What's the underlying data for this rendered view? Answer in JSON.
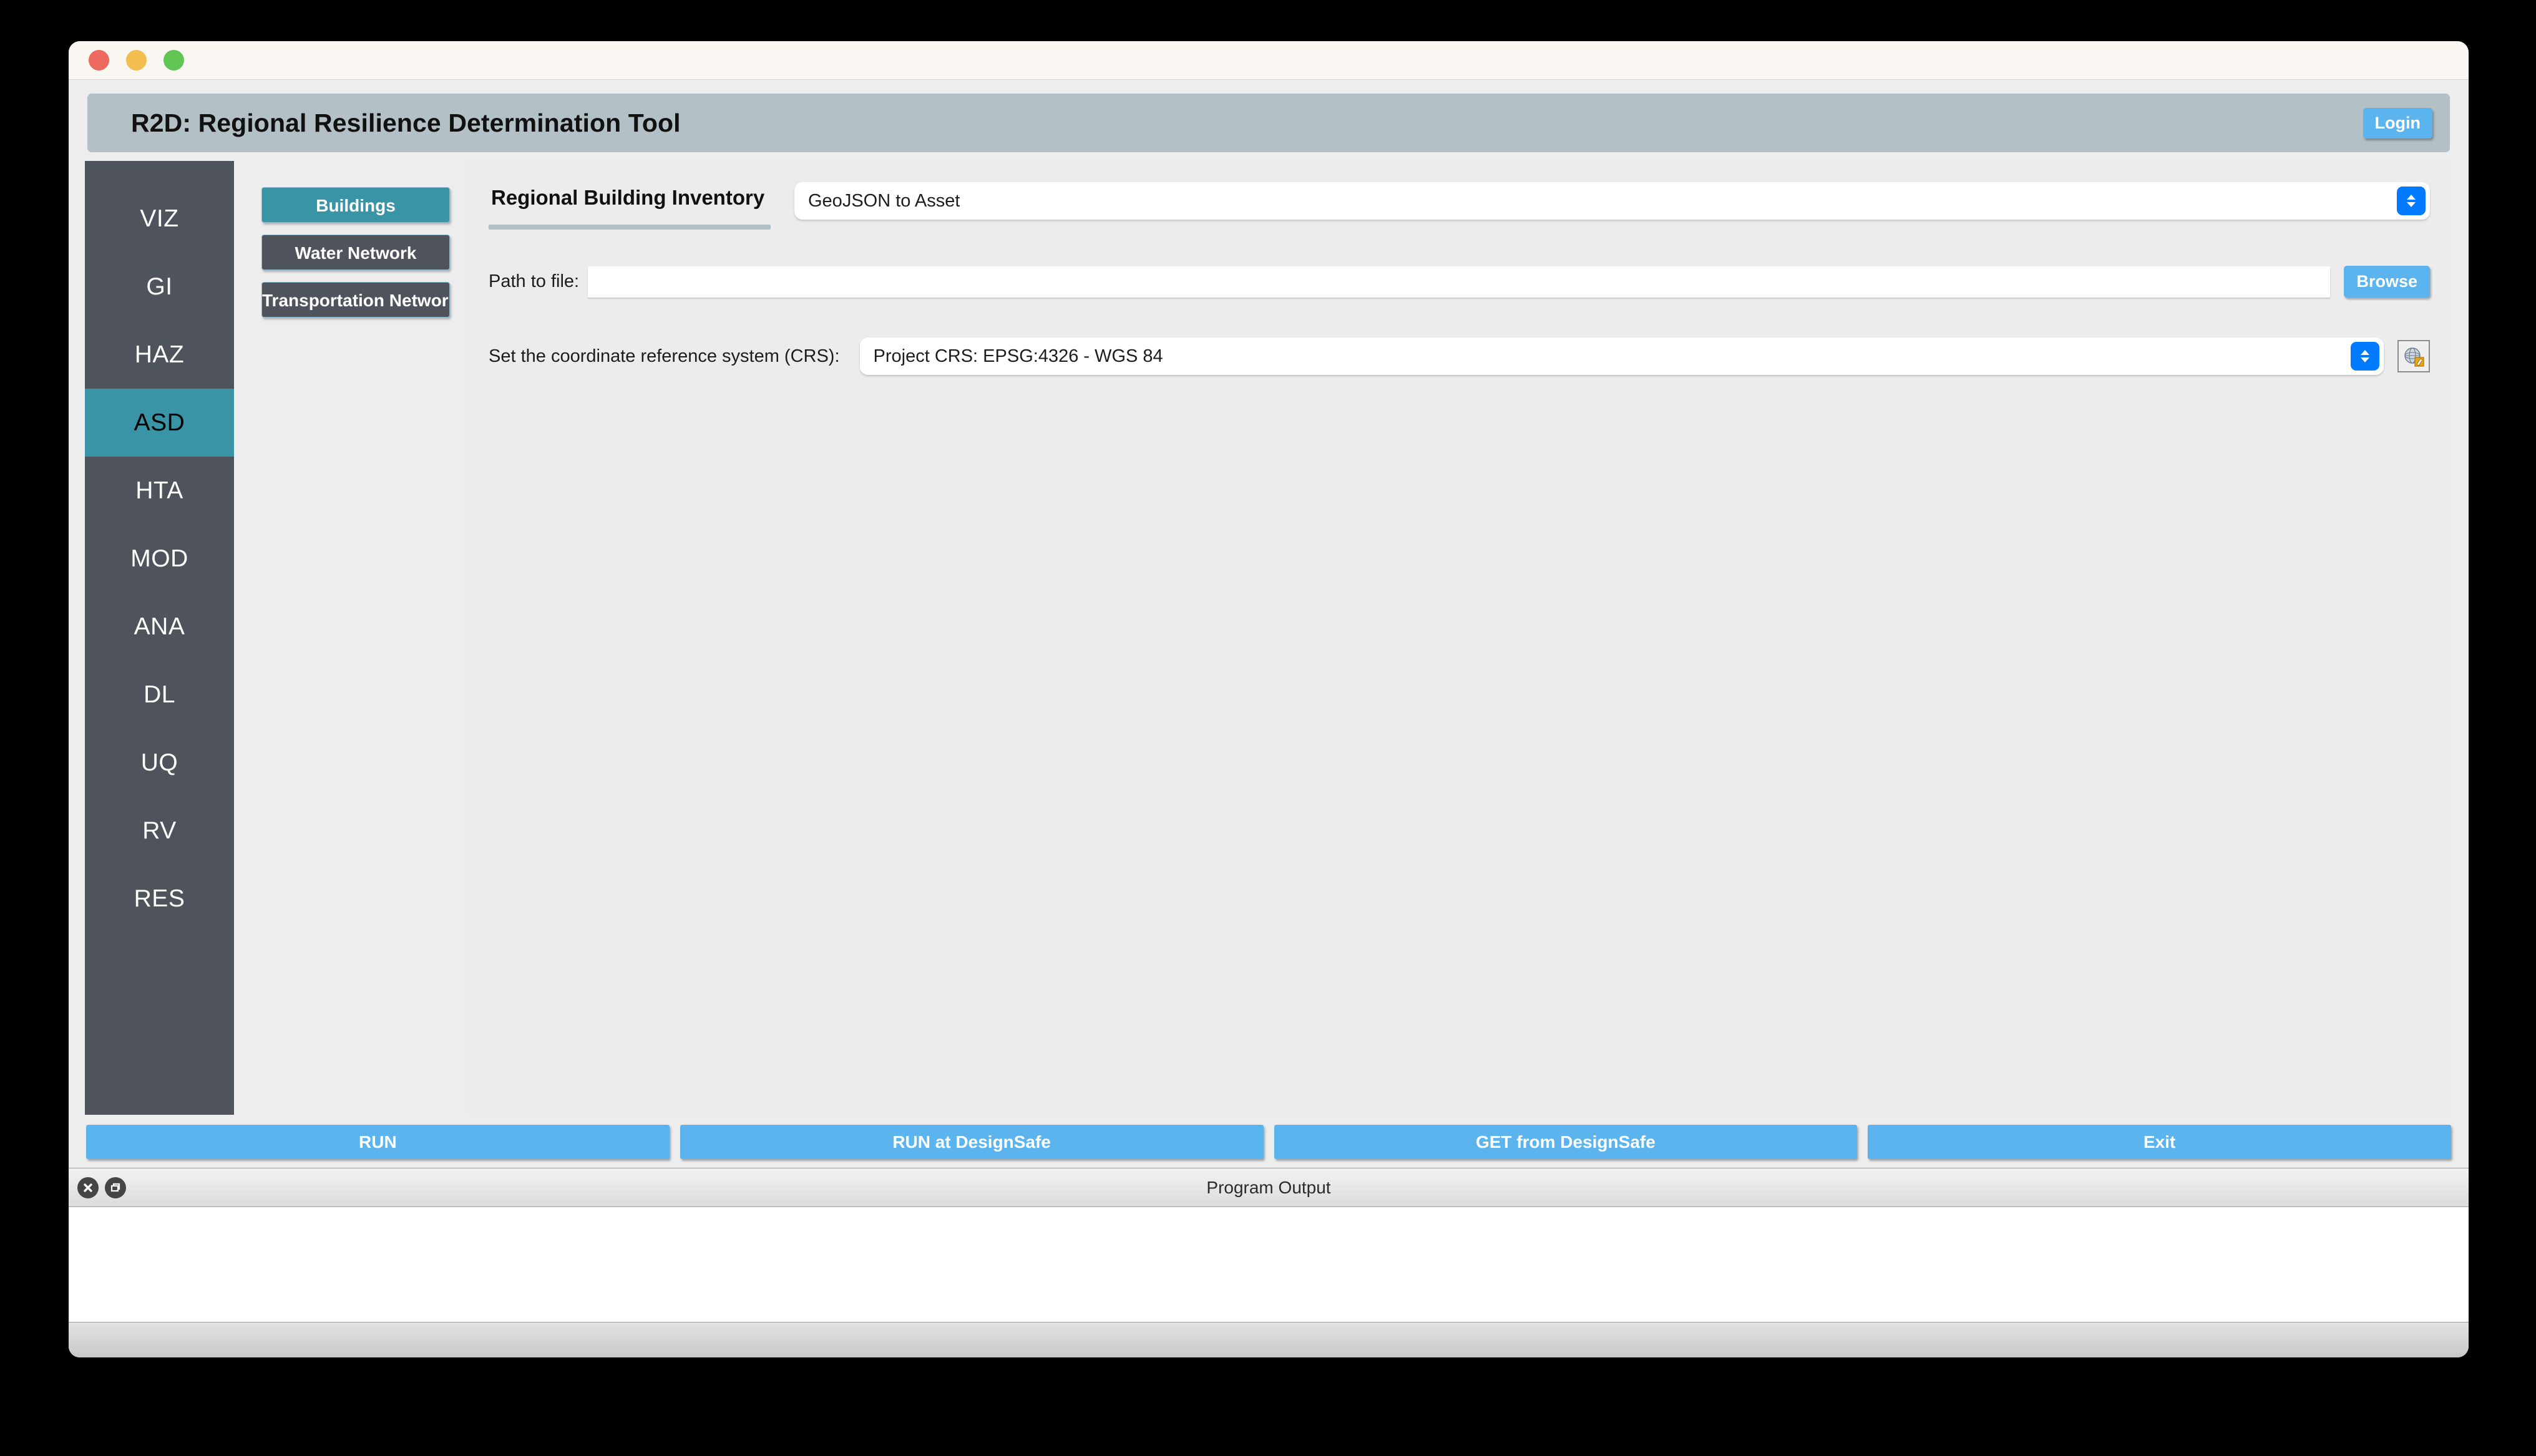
{
  "window": {
    "traffic_lights": [
      "close-red",
      "minimize-yellow",
      "maximize-green"
    ]
  },
  "header": {
    "title": "R2D: Regional Resilience Determination Tool",
    "login_label": "Login",
    "banner_color": "#b3c0c6",
    "accent_blue": "#5cb4ef"
  },
  "sidebar": {
    "background": "#4e535c",
    "active_color": "#3994a5",
    "active_index": 3,
    "items": [
      {
        "label": "VIZ"
      },
      {
        "label": "GI"
      },
      {
        "label": "HAZ"
      },
      {
        "label": "ASD"
      },
      {
        "label": "HTA"
      },
      {
        "label": "MOD"
      },
      {
        "label": "ANA"
      },
      {
        "label": "DL"
      },
      {
        "label": "UQ"
      },
      {
        "label": "RV"
      },
      {
        "label": "RES"
      }
    ]
  },
  "asset_types": {
    "active_index": 0,
    "items": [
      {
        "label": "Buildings"
      },
      {
        "label": "Water Network"
      },
      {
        "label": "Transportation Network"
      }
    ]
  },
  "panel": {
    "section_title": "Regional Building Inventory",
    "inventory_method": "GeoJSON to Asset",
    "path_label": "Path to file:",
    "path_value": "",
    "path_placeholder": "",
    "browse_label": "Browse",
    "crs_label": "Set the coordinate reference system (CRS):",
    "crs_value": "Project CRS: EPSG:4326 - WGS 84",
    "crs_icon": "globe-edit-icon"
  },
  "actions": [
    {
      "label": "RUN"
    },
    {
      "label": "RUN at DesignSafe"
    },
    {
      "label": "GET from DesignSafe"
    },
    {
      "label": "Exit"
    }
  ],
  "program_output": {
    "title": "Program Output",
    "close_icon": "close-icon",
    "float_icon": "undock-icon",
    "text": ""
  }
}
